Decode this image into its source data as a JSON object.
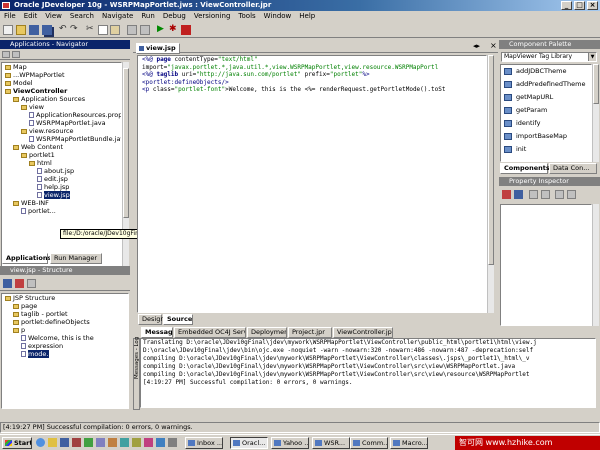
{
  "window": {
    "title": "Oracle JDeveloper 10g - WSRPMapPortlet.jws : ViewController.jpr"
  },
  "menu": [
    "File",
    "Edit",
    "View",
    "Search",
    "Navigate",
    "Run",
    "Debug",
    "Versioning",
    "Tools",
    "Window",
    "Help"
  ],
  "navigator": {
    "title": "Applications - Navigator",
    "items": [
      {
        "label": "Map",
        "level": 0
      },
      {
        "label": "...WPMapPortlet",
        "level": 0
      },
      {
        "label": "Model",
        "level": 0
      },
      {
        "label": "ViewController",
        "level": 0,
        "bold": true
      },
      {
        "label": "Application Sources",
        "level": 1
      },
      {
        "label": "view",
        "level": 2
      },
      {
        "label": "ApplicationResources.proper",
        "level": 3
      },
      {
        "label": "WSRPMapPortlet.java",
        "level": 3
      },
      {
        "label": "view.resource",
        "level": 2
      },
      {
        "label": "WSRPMapPortletBundle.java",
        "level": 3
      },
      {
        "label": "Web Content",
        "level": 1
      },
      {
        "label": "portlet1",
        "level": 2
      },
      {
        "label": "html",
        "level": 3
      },
      {
        "label": "about.jsp",
        "level": 4
      },
      {
        "label": "edit.jsp",
        "level": 4
      },
      {
        "label": "help.jsp",
        "level": 4
      },
      {
        "label": "view.jsp",
        "level": 4,
        "selected": true
      },
      {
        "label": "WEB-INF",
        "level": 1
      },
      {
        "label": "portlet...",
        "level": 2
      }
    ],
    "tabs": [
      "Applications",
      "Run Manager"
    ]
  },
  "tooltip": "file:/D:/oracle/JDev10gFinal/jdev/mywork/WSRPMapPortlet/ViewController/public_html/portlet1/html/view.jsp",
  "structure": {
    "title": "view.jsp - Structure",
    "items": [
      {
        "label": "JSP Structure",
        "level": 0
      },
      {
        "label": "page",
        "level": 1
      },
      {
        "label": "taglib - portlet",
        "level": 1
      },
      {
        "label": "portlet:defineObjects",
        "level": 1
      },
      {
        "label": "p",
        "level": 1
      },
      {
        "label": "Welcome, this is the",
        "level": 2
      },
      {
        "label": "expression",
        "level": 2
      },
      {
        "label": "mode.",
        "level": 2,
        "selected": true
      }
    ]
  },
  "editor": {
    "tab": "view.jsp",
    "lines": [
      [
        {
          "t": "<%@ ",
          "c": "tag"
        },
        {
          "t": "page ",
          "c": "kw"
        },
        {
          "t": "contentType=",
          "c": ""
        },
        {
          "t": "\"text/html\"",
          "c": "str"
        }
      ],
      [
        {
          "t": "        import=",
          "c": ""
        },
        {
          "t": "\"javax.portlet.*,java.util.*,view.WSRPMapPortlet,view.resource.WSRPMapPortl",
          "c": "str"
        }
      ],
      [
        {
          "t": "<%@ ",
          "c": "tag"
        },
        {
          "t": "taglib ",
          "c": "kw"
        },
        {
          "t": "uri=",
          "c": ""
        },
        {
          "t": "\"http://java.sun.com/portlet\"",
          "c": "str"
        },
        {
          "t": " prefix=",
          "c": ""
        },
        {
          "t": "\"portlet\"",
          "c": "str"
        },
        {
          "t": "%>",
          "c": "tag"
        }
      ],
      [
        {
          "t": "<portlet:defineObjects/>",
          "c": "tag"
        }
      ],
      [
        {
          "t": "<p ",
          "c": "tag"
        },
        {
          "t": "class=",
          "c": ""
        },
        {
          "t": "\"portlet-font\"",
          "c": "str"
        },
        {
          "t": ">Welcome, this is the <%= renderRequest.getPortletMode().toSt",
          "c": ""
        }
      ]
    ],
    "bottom_tabs": [
      "Design",
      "Source"
    ]
  },
  "palette": {
    "title": "Component Palette",
    "library": "MapViewer Tag Library",
    "items": [
      "addJDBCTheme",
      "addPredefinedTheme",
      "getMapURL",
      "getParam",
      "identify",
      "importBaseMap",
      "init"
    ],
    "tabs": [
      "Components",
      "Data Con..."
    ]
  },
  "inspector": {
    "title": "Property Inspector"
  },
  "messages": {
    "tabs": [
      "Messages",
      "Embedded OC4J Server",
      "Deployment",
      "Project.jpr",
      "ViewController.jpr"
    ],
    "side_label": "Messages - Log",
    "lines": [
      "Translating D:\\oracle\\JDev10gFinal\\jdev\\mywork\\WSRPMapPortlet\\ViewController\\public_html\\portlet1\\html\\view.j",
      "D:\\oracle\\JDev10gFinal\\jdev\\bin\\ojc.exe -noquiet -warn -nowarn:320 -nowarn:486 -nowarn:487 -deprecation:self",
      "  compiling D:\\oracle\\JDev10gFinal\\jdev\\mywork\\WSRPMapPortlet\\ViewController\\classes\\.jsps\\_portlet1\\_html\\_v",
      "  compiling D:\\oracle\\JDev10gFinal\\jdev\\mywork\\WSRPMapPortlet\\ViewController\\src\\view\\WSRPMapPortlet.java",
      "  compiling D:\\oracle\\JDev10gFinal\\jdev\\mywork\\WSRPMapPortlet\\ViewController\\src\\view\\resource\\WSRPMapPortlet",
      "[4:19:27 PM] Successful compilation: 0 errors, 0 warnings."
    ]
  },
  "status": "[4:19:27 PM] Successful compilation: 0 errors, 0 warnings.",
  "taskbar": {
    "start": "Start",
    "tasks": [
      "Inbox ...",
      "Oracl...",
      "Yahoo ...",
      "WSR...",
      "Comm...",
      "Macro..."
    ],
    "tray_text": "智可网 www.hzhike.com"
  }
}
